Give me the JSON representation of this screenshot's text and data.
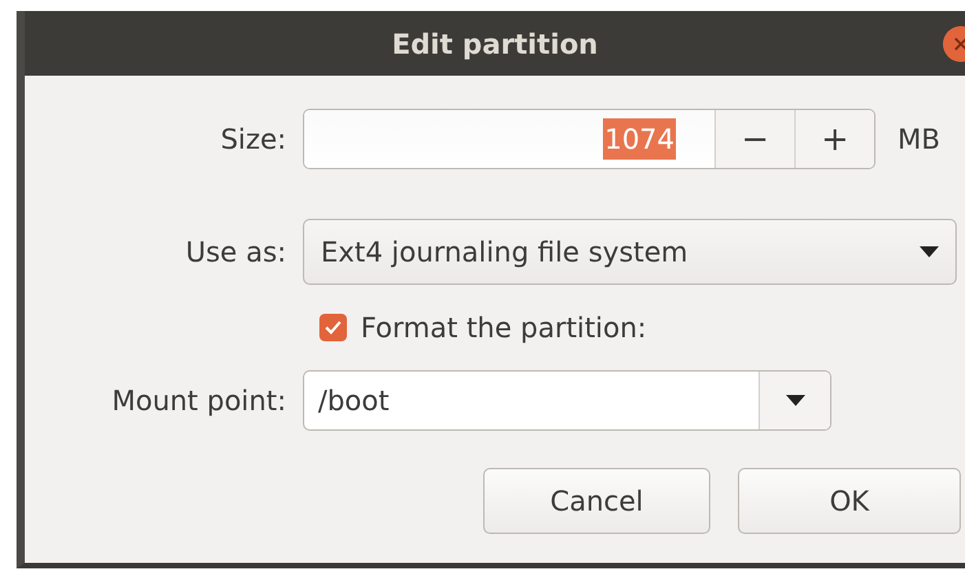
{
  "window": {
    "title": "Edit partition"
  },
  "size": {
    "label": "Size:",
    "value": "1074",
    "selected": true,
    "minus": "−",
    "plus": "+",
    "unit": "MB"
  },
  "use_as": {
    "label": "Use as:",
    "value": "Ext4 journaling file system"
  },
  "format": {
    "label": "Format the partition:",
    "checked": true
  },
  "mount_point": {
    "label": "Mount point:",
    "value": "/boot"
  },
  "buttons": [
    {
      "label": "Cancel"
    },
    {
      "label": "OK"
    }
  ]
}
